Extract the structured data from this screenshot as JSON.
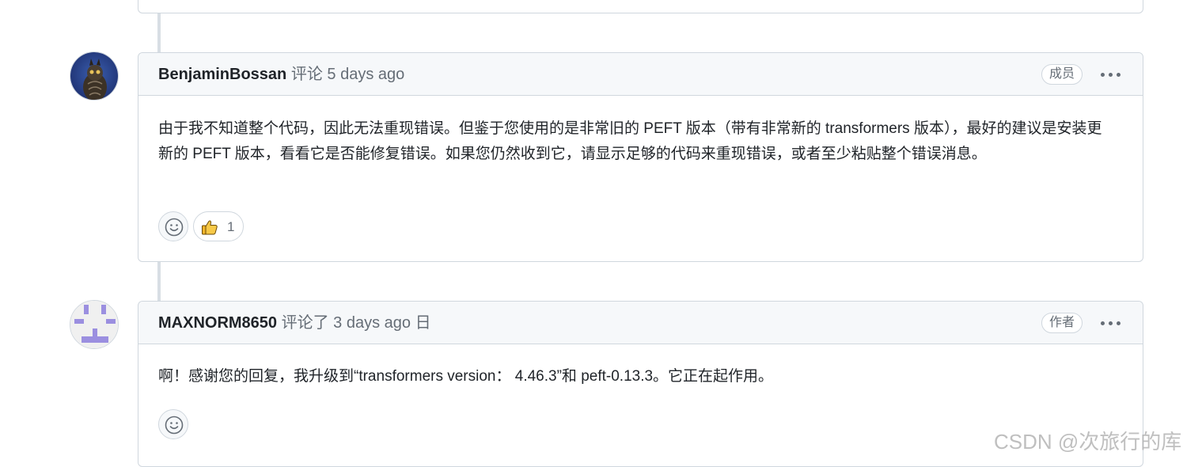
{
  "comments": [
    {
      "author": "BenjaminBossan",
      "action": "评论",
      "time": "5 days ago",
      "suffix": "",
      "role": "成员",
      "body": "由于我不知道整个代码，因此无法重现错误。但鉴于您使用的是非常旧的 PEFT 版本（带有非常新的 transformers 版本），最好的建议是安装更新的 PEFT 版本，看看它是否能修复错误。如果您仍然收到它，请显示足够的代码来重现错误，或者至少粘贴整个错误消息。",
      "reactions": [
        {
          "icon": "thumbs-up-icon",
          "count": "1"
        }
      ]
    },
    {
      "author": "MAXNORM8650",
      "action": "评论了",
      "time": "3 days ago",
      "suffix": "日",
      "role": "作者",
      "body": "啊！感谢您的回复，我升级到“transformers version： 4.46.3”和 peft-0.13.3。它正在起作用。",
      "reactions": []
    }
  ],
  "icons": {
    "more": "kebab-horizontal-icon",
    "add_reaction": "smiley-icon"
  },
  "colors": {
    "header_bg": "#f6f8fa",
    "border": "#d0d7de",
    "muted_text": "#656d76",
    "timeline": "#d8dee4",
    "identicon": "#9b8fe0"
  },
  "watermark": "CSDN @次旅行的库"
}
